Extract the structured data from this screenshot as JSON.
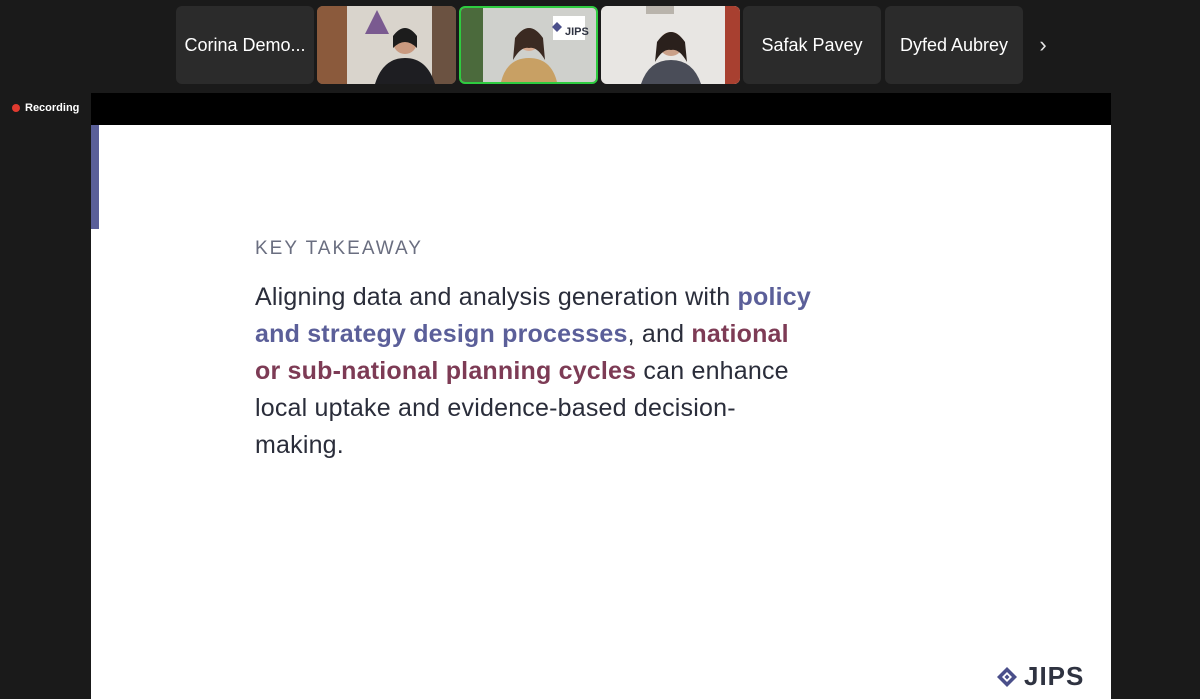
{
  "participants": [
    {
      "name": "Corina Demo...",
      "type": "name"
    },
    {
      "name": "",
      "type": "video"
    },
    {
      "name": "",
      "type": "video-active"
    },
    {
      "name": "",
      "type": "video"
    },
    {
      "name": "Safak Pavey",
      "type": "name"
    },
    {
      "name": "Dyfed Aubrey",
      "type": "name"
    }
  ],
  "strip": {
    "next_icon": "chevron-right-icon",
    "next_glyph": "›"
  },
  "recording": {
    "label": "Recording",
    "color": "#e03a2f"
  },
  "slide": {
    "label": "KEY TAKEAWAY",
    "body": {
      "part1": "Aligning data and analysis generation with ",
      "highlight1": "policy and strategy design processes",
      "part2": ", and ",
      "highlight2": "national or sub-national planning cycles",
      "part3": " can enhance local uptake and evidence-based decision-making."
    },
    "logo_text": "JIPS",
    "accent_color": "#5a5f99",
    "highlight_colors": {
      "blue": "#5b5f99",
      "plum": "#7d3b55"
    }
  },
  "jips_tile_logo": "JIPS"
}
